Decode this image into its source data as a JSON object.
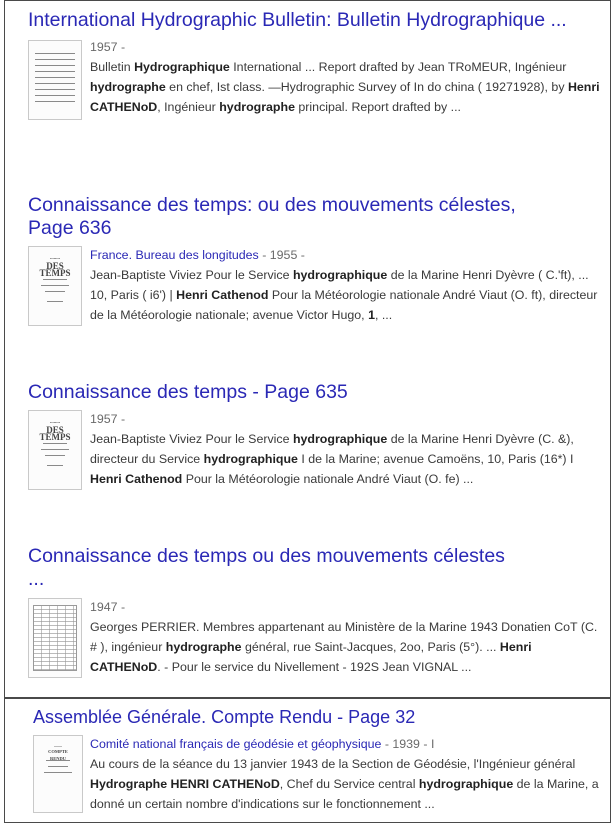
{
  "results": [
    {
      "title": "International Hydrographic Bulletin: Bulletin Hydrographique ...",
      "source": "",
      "meta": "1957 -",
      "snippet_parts": [
        [
          "Bulletin ",
          false
        ],
        [
          "Hydrographique",
          true
        ],
        [
          " International ... Report drafted by Jean TRoMEUR, Ingénieur ",
          false
        ],
        [
          "hydrographe",
          true
        ],
        [
          " en chef, Ist class. —Hydrographic Survey of In do china ( 19271928), by ",
          false
        ],
        [
          "Henri CATHENoD",
          true
        ],
        [
          ", Ingénieur ",
          false
        ],
        [
          "hydrographe",
          true
        ],
        [
          " principal. Report drafted by ...",
          false
        ]
      ]
    },
    {
      "title": "Connaissance des temps: ou des mouvements célestes, Page 636",
      "source": "France. Bureau des longitudes",
      "meta": " - 1955 -",
      "snippet_parts": [
        [
          "Jean-Baptiste Viviez Pour le Service ",
          false
        ],
        [
          "hydrographique",
          true
        ],
        [
          " de la Marine Henri Dyèvre ( C.'ft), ... 10, Paris ( i6') | ",
          false
        ],
        [
          "Henri Cathenod",
          true
        ],
        [
          " Pour la Météorologie nationale André Viaut (O. ft), directeur de la Météorologie nationale; avenue Victor Hugo, ",
          false
        ],
        [
          "1",
          true
        ],
        [
          ", ...",
          false
        ]
      ]
    },
    {
      "title": "Connaissance des temps - Page 635",
      "source": "",
      "meta": "1957 -",
      "snippet_parts": [
        [
          "Jean-Baptiste Viviez Pour le Service ",
          false
        ],
        [
          "hydrographique",
          true
        ],
        [
          " de la Marine Henri Dyèvre (C. &), directeur du Service ",
          false
        ],
        [
          "hydrographique",
          true
        ],
        [
          " I de la Marine; avenue Camoëns, 10, Paris (16*) I ",
          false
        ],
        [
          "Henri Cathenod",
          true
        ],
        [
          " Pour la Météorologie nationale André Viaut (O. fe) ...",
          false
        ]
      ]
    },
    {
      "title": "Connaissance des temps ou des mouvements célestes ...",
      "source": "",
      "meta": "1947 -",
      "snippet_parts": [
        [
          "Georges PERRIER. Membres appartenant au Ministère de la Marine 1943 Donatien CoT (C. # ), ingénieur ",
          false
        ],
        [
          "hydrographe",
          true
        ],
        [
          " général, rue Saint-Jacques, 2oo, Paris (5°). ... ",
          false
        ],
        [
          "Henri CATHENoD",
          true
        ],
        [
          ". - Pour le service du Nivellement - 192S Jean VIGNAL ...",
          false
        ]
      ]
    },
    {
      "title": "Assemblée Générale. Compte Rendu - Page 32",
      "source": "Comité national français de géodésie et géophysique",
      "meta": " - 1939 - I",
      "snippet_parts": [
        [
          "Au cours de la séance du 13 janvier 1943 de la Section de Géodésie, l'Ingénieur général ",
          false
        ],
        [
          "Hydrographe HENRI CATHENoD",
          true
        ],
        [
          ", Chef du Service central ",
          false
        ],
        [
          "hydrographique",
          true
        ],
        [
          " de la Marine, a donné un certain nombre d'indications sur le fonctionnement ...",
          false
        ]
      ]
    }
  ],
  "thumbnails": [
    {
      "heading": ""
    },
    {
      "heading": "DES TEMPS"
    },
    {
      "heading": "DES TEMPS"
    },
    {
      "heading": ""
    },
    {
      "heading": "COMPTE RENDU"
    }
  ]
}
